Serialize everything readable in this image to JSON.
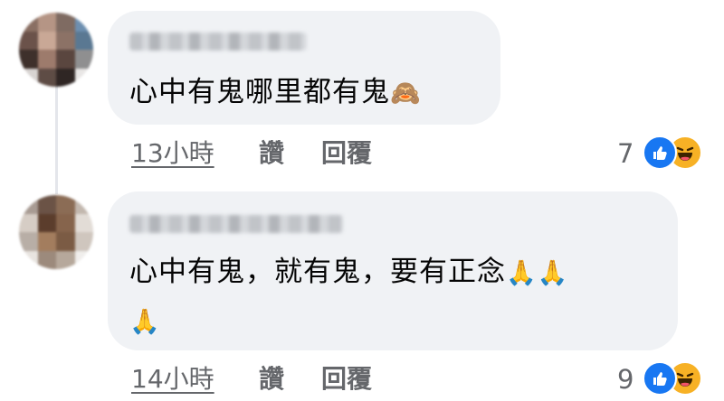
{
  "comments": [
    {
      "text": "心中有鬼哪里都有鬼",
      "emoji_line1": "🙈",
      "time": "13小時",
      "like_label": "讚",
      "reply_label": "回覆",
      "reaction_count": "7",
      "reaction_icons": [
        "like-icon",
        "haha-icon"
      ]
    },
    {
      "text": "心中有鬼，就有鬼，要有正念",
      "emoji_line1": "🙏🙏",
      "emoji_line2": "🙏",
      "time": "14小時",
      "like_label": "讚",
      "reply_label": "回覆",
      "reaction_count": "9",
      "reaction_icons": [
        "like-icon",
        "haha-icon"
      ]
    }
  ],
  "colors": {
    "bubble": "#f0f2f5",
    "meta_text": "#65676b",
    "like_blue": "#1877f2",
    "haha_yellow": "#f7b125"
  }
}
